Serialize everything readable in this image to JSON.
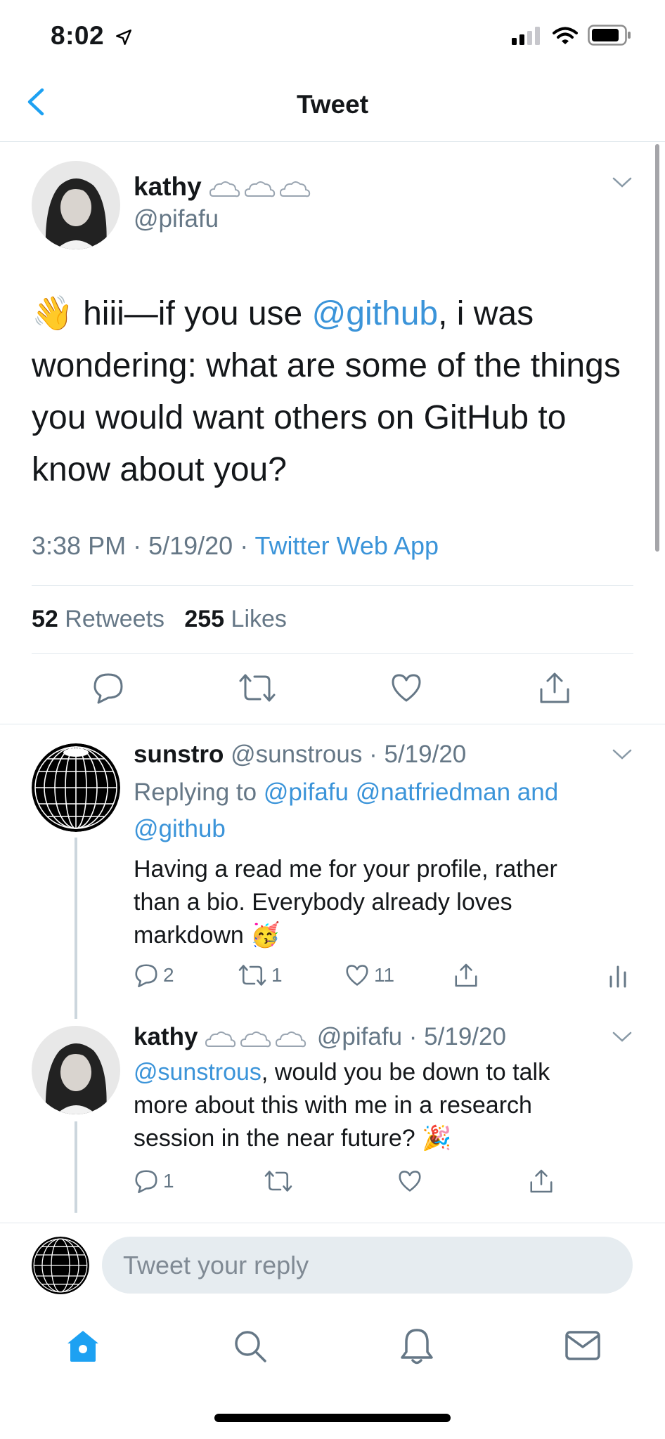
{
  "status_bar": {
    "time": "8:02"
  },
  "nav": {
    "title": "Tweet"
  },
  "main_tweet": {
    "name": "kathy",
    "handle": "@pifafu",
    "text_parts": {
      "emoji": "👋",
      "pre": " hiii—if you use ",
      "mention": "@github",
      "post": ", i was wondering: what are some of the things you would want others on GitHub to know about you?"
    },
    "time": "3:38 PM",
    "date": "5/19/20",
    "source": "Twitter Web App",
    "retweets_count": "52",
    "retweets_label": "Retweets",
    "likes_count": "255",
    "likes_label": "Likes"
  },
  "replies": [
    {
      "name": "sunstro",
      "handle": "@sunstrous",
      "date": "5/19/20",
      "replying_prefix": "Replying to ",
      "replying_to": "@pifafu @natfriedman and",
      "replying_to_2": "@github",
      "body_line1": "Having a read me for your profile, rather",
      "body_line2": "than a bio. Everybody already loves",
      "body_line3": "markdown",
      "body_emoji": "🥳",
      "reply_count": "2",
      "retweet_count": "1",
      "like_count": "11"
    },
    {
      "name": "kathy",
      "handle": "@pifafu",
      "date": "5/19/20",
      "mention": "@sunstrous",
      "body_line1": ", would you be down to talk",
      "body_line2": "more about this with me in a research",
      "body_line3": "session in the near future?",
      "body_emoji": "🎉",
      "reply_count": "1"
    }
  ],
  "compose": {
    "placeholder": "Tweet your reply"
  },
  "colors": {
    "accent": "#1da1f2",
    "link": "#3b94d9",
    "muted": "#657786",
    "divider": "#e1e8ed"
  },
  "icons": [
    "back-chevron-icon",
    "caret-down-icon",
    "reply-icon",
    "retweet-icon",
    "like-icon",
    "share-icon",
    "analytics-icon",
    "home-icon",
    "search-icon",
    "notifications-icon",
    "messages-icon"
  ]
}
